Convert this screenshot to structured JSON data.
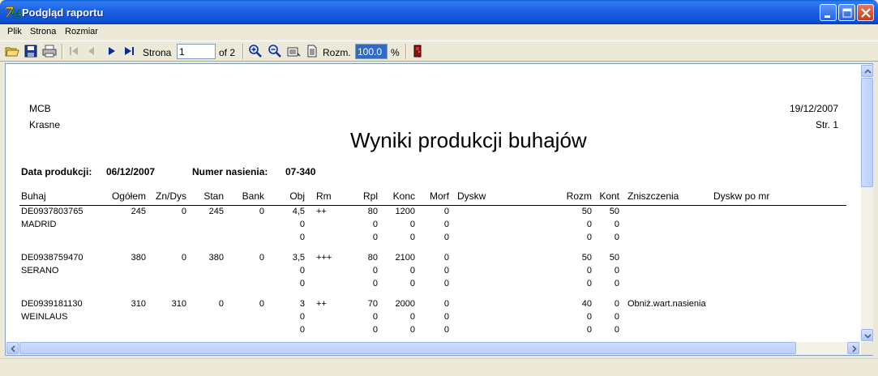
{
  "window": {
    "title": "Podgląd raportu"
  },
  "menu": [
    {
      "label": "Plik"
    },
    {
      "label": "Strona"
    },
    {
      "label": "Rozmiar"
    }
  ],
  "toolbar": {
    "page_label": "Strona",
    "page_value": "1",
    "page_total": "of 2",
    "zoom_label": "Rozm.",
    "zoom_value": "100.0",
    "zoom_unit": "%"
  },
  "report": {
    "company": "MCB",
    "location": "Krasne",
    "date": "19/12/2007",
    "page": "Str. 1",
    "title": "Wyniki produkcji buhajów",
    "prod_date_label": "Data produkcji:",
    "prod_date_value": "06/12/2007",
    "semen_no_label": "Numer nasienia:",
    "semen_no_value": "07-340",
    "columns": [
      "Buhaj",
      "Ogółem",
      "Zn/Dys",
      "Stan",
      "Bank",
      "Obj",
      "Rm",
      "Rpl",
      "Konc",
      "Morf",
      "Dyskw",
      "Rozm",
      "Kont",
      "Zniszczenia",
      "Dyskw po mr"
    ],
    "rows": [
      {
        "id": "DE0937803765",
        "name": "MADRID",
        "ogolem": "245",
        "zndys": "0",
        "stan": "245",
        "bank": "0",
        "obj": [
          "4,5",
          "0",
          "0"
        ],
        "rm": "++",
        "rpl": [
          "80",
          "0",
          "0"
        ],
        "konc": [
          "1200",
          "0",
          "0"
        ],
        "morf": [
          "0",
          "0",
          "0"
        ],
        "rozm": [
          "50",
          "0",
          "0"
        ],
        "kont": [
          "50",
          "0",
          "0"
        ],
        "zniszczenia": ""
      },
      {
        "id": "DE0938759470",
        "name": "SERANO",
        "ogolem": "380",
        "zndys": "0",
        "stan": "380",
        "bank": "0",
        "obj": [
          "3,5",
          "0",
          "0"
        ],
        "rm": "+++",
        "rpl": [
          "80",
          "0",
          "0"
        ],
        "konc": [
          "2100",
          "0",
          "0"
        ],
        "morf": [
          "0",
          "0",
          "0"
        ],
        "rozm": [
          "50",
          "0",
          "0"
        ],
        "kont": [
          "50",
          "0",
          "0"
        ],
        "zniszczenia": ""
      },
      {
        "id": "DE0939181130",
        "name": "WEINLAUS",
        "ogolem": "310",
        "zndys": "310",
        "stan": "0",
        "bank": "0",
        "obj": [
          "3",
          "0",
          "0"
        ],
        "rm": "++",
        "rpl": [
          "70",
          "0",
          "0"
        ],
        "konc": [
          "2000",
          "0",
          "0"
        ],
        "morf": [
          "0",
          "0",
          "0"
        ],
        "rozm": [
          "40",
          "0",
          "0"
        ],
        "kont": [
          "0",
          "0",
          "0"
        ],
        "zniszczenia": "Obniż.wart.nasienia"
      }
    ]
  },
  "colors": {
    "titlebar": "#0b4fd4",
    "selection": "#316ac5",
    "chrome": "#ece9d8"
  }
}
